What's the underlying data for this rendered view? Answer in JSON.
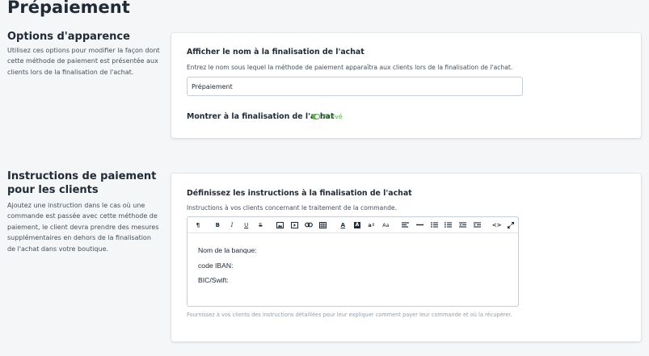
{
  "page": {
    "title": "Prépaiement"
  },
  "appearance": {
    "section_title": "Options d'apparence",
    "section_description": "Utilisez ces options pour modifier la façon dont cette méthode de paiement est présentée aux clients lors de la finalisation de l'achat.",
    "name_heading": "Afficher le nom à la finalisation de l'achat",
    "name_help": "Entrez le nom sous lequel la méthode de paiement apparaîtra aux clients lors de la finalisation de l'achat.",
    "name_value": "Prépaiement",
    "show_heading": "Montrer à la finalisation de l'achat",
    "show_status": "Activé",
    "show_status_color": "#50b83c"
  },
  "instructions": {
    "section_title": "Instructions de paiement pour les clients",
    "section_description": "Ajoutez une instruction dans le cas où une commande est passée avec cette méthode de paiement, le client devra prendre des mesures supplémentaires en dehors de la finalisation de l'achat dans votre boutique.",
    "heading": "Définissez les instructions à la finalisation de l'achat",
    "help": "Instructions à vos clients concernant le traitement de la commande.",
    "toolbar_icons": [
      "paragraph-icon",
      "bold-icon",
      "italic-icon",
      "underline-icon",
      "strikethrough-icon",
      "image-icon",
      "video-icon",
      "link-icon",
      "table-icon",
      "text-color-icon",
      "background-color-icon",
      "font-size-icon",
      "text-case-icon",
      "align-icon",
      "horizontal-rule-icon",
      "unordered-list-icon",
      "ordered-list-icon",
      "outdent-icon",
      "indent-icon",
      "code-view-icon",
      "fullscreen-icon"
    ],
    "editor_lines": [
      "Nom de la banque:",
      "code IBAN:",
      "BIC/Swift:"
    ],
    "footer": "Fournissez à vos clients des instructions détaillées pour leur expliquer comment payer leur commande et où la récupérer."
  }
}
